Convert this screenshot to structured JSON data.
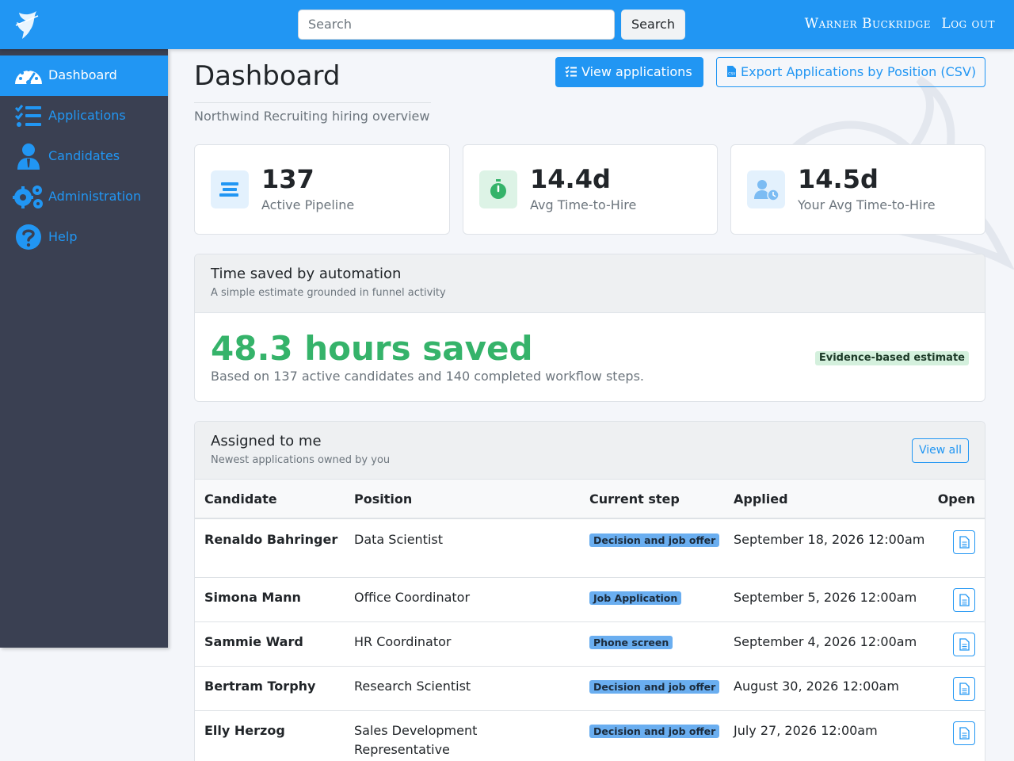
{
  "header": {
    "search_placeholder": "Search",
    "search_button": "Search",
    "user_name": "Warner Buckridge",
    "logout": "Log out"
  },
  "sidebar": {
    "items": [
      {
        "label": "Dashboard",
        "icon": "gauge-icon",
        "active": true
      },
      {
        "label": "Applications",
        "icon": "list-check-icon",
        "active": false
      },
      {
        "label": "Candidates",
        "icon": "user-tie-icon",
        "active": false
      },
      {
        "label": "Administration",
        "icon": "gears-icon",
        "active": false
      },
      {
        "label": "Help",
        "icon": "question-circle-icon",
        "active": false
      }
    ]
  },
  "page": {
    "title": "Dashboard",
    "subtitle": "Northwind Recruiting hiring overview",
    "view_applications": "View applications",
    "export_csv": "Export Applications by Position (CSV)"
  },
  "stats": [
    {
      "value": "137",
      "label": "Active Pipeline",
      "icon": "bars-icon"
    },
    {
      "value": "14.4d",
      "label": "Avg Time-to-Hire",
      "icon": "stopwatch-icon"
    },
    {
      "value": "14.5d",
      "label": "Your Avg Time-to-Hire",
      "icon": "user-clock-icon"
    }
  ],
  "automation": {
    "title": "Time saved by automation",
    "subtitle": "A simple estimate grounded in funnel activity",
    "hours_saved": "48.3 hours saved",
    "note": "Based on 137 active candidates and 140 completed workflow steps.",
    "badge": "Evidence-based estimate"
  },
  "assigned": {
    "title": "Assigned to me",
    "subtitle": "Newest applications owned by you",
    "view_all": "View all",
    "columns": [
      "Candidate",
      "Position",
      "Current step",
      "Applied",
      "Open"
    ],
    "rows": [
      {
        "candidate": "Renaldo Bahringer",
        "position": "Data Scientist",
        "step": "Decision and job offer",
        "applied": "September 18, 2026 12:00am"
      },
      {
        "candidate": "Simona Mann",
        "position": "Office Coordinator",
        "step": "Job Application",
        "applied": "September 5, 2026 12:00am"
      },
      {
        "candidate": "Sammie Ward",
        "position": "HR Coordinator",
        "step": "Phone screen",
        "applied": "September 4, 2026 12:00am"
      },
      {
        "candidate": "Bertram Torphy",
        "position": "Research Scientist",
        "step": "Decision and job offer",
        "applied": "August 30, 2026 12:00am"
      },
      {
        "candidate": "Elly Herzog",
        "position": "Sales Development Representative",
        "step": "Decision and job offer",
        "applied": "July 27, 2026 12:00am"
      }
    ]
  },
  "colors": {
    "primary": "#2196f3",
    "sidebar": "#3a4052",
    "success": "#35b36a"
  }
}
